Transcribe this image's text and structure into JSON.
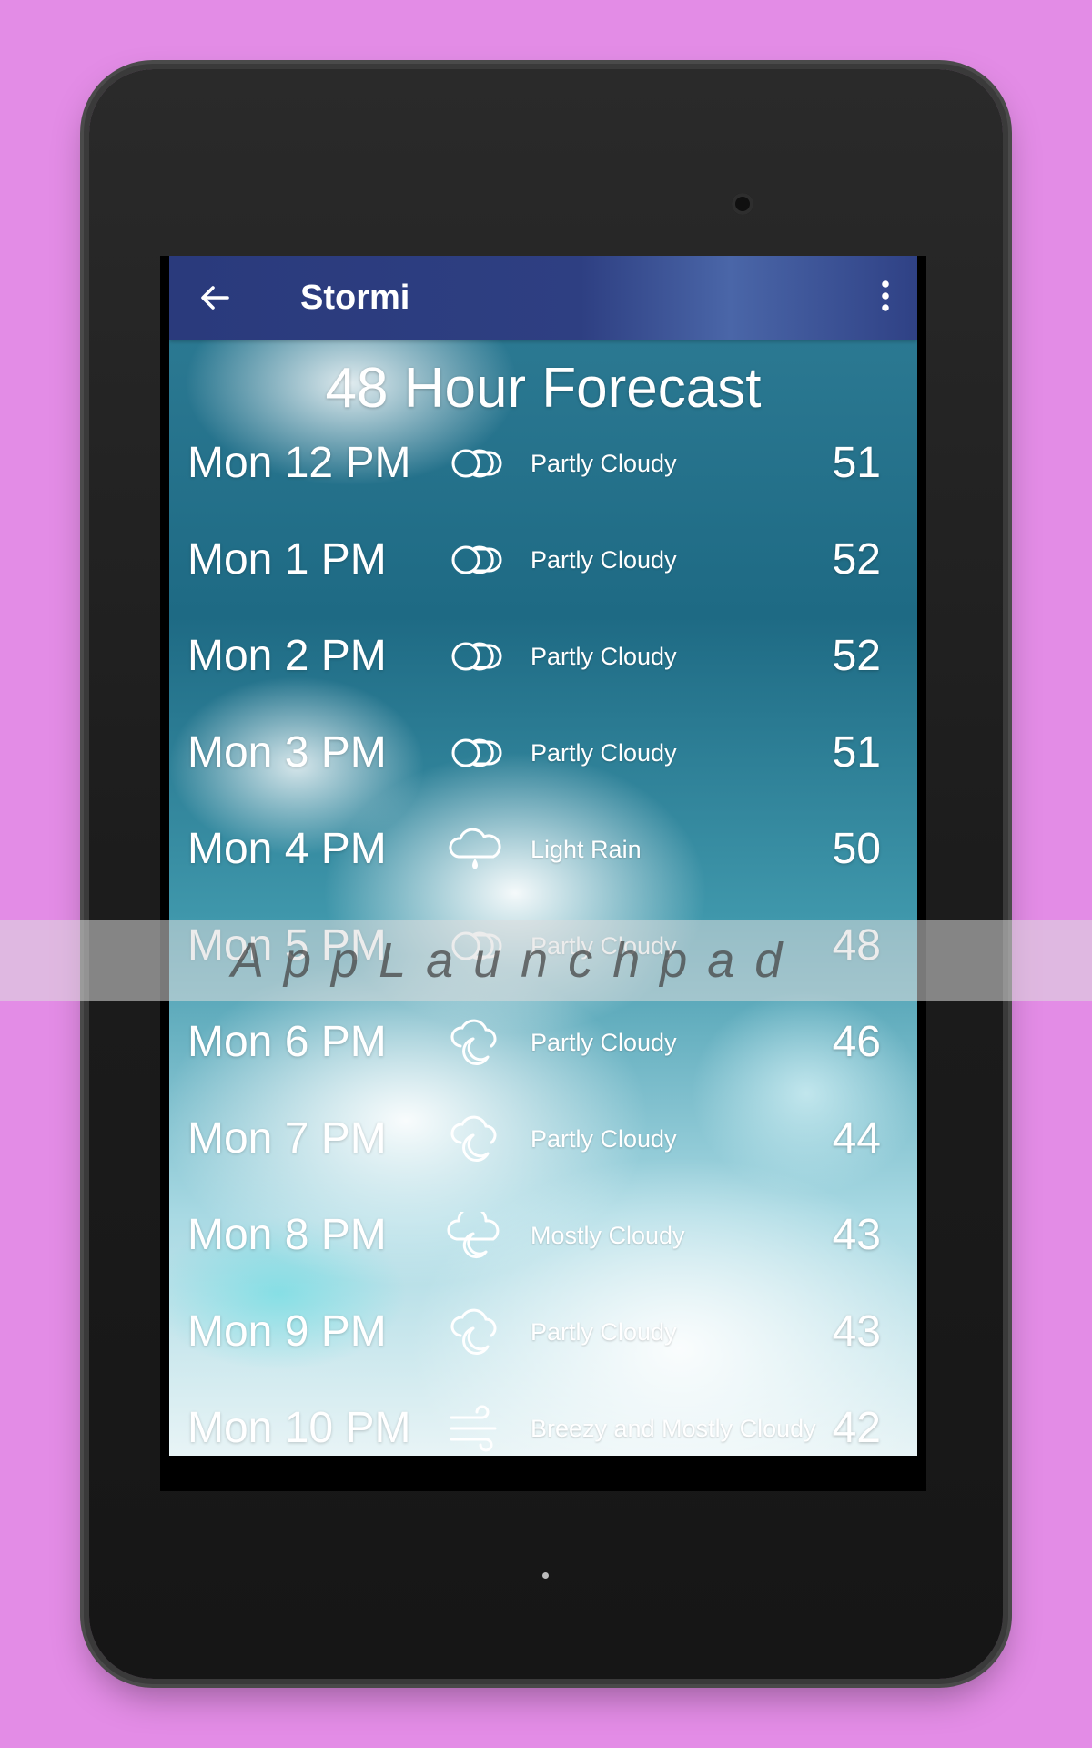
{
  "app": {
    "title": "Stormi",
    "page_title": "48 Hour Forecast"
  },
  "forecast": [
    {
      "time": "Mon 12 PM",
      "icon": "partly-cloudy-icon",
      "condition": "Partly Cloudy",
      "temp": "51"
    },
    {
      "time": "Mon 1 PM",
      "icon": "partly-cloudy-icon",
      "condition": "Partly Cloudy",
      "temp": "52"
    },
    {
      "time": "Mon 2 PM",
      "icon": "partly-cloudy-icon",
      "condition": "Partly Cloudy",
      "temp": "52"
    },
    {
      "time": "Mon 3 PM",
      "icon": "partly-cloudy-icon",
      "condition": "Partly Cloudy",
      "temp": "51"
    },
    {
      "time": "Mon 4 PM",
      "icon": "light-rain-icon",
      "condition": "Light Rain",
      "temp": "50"
    },
    {
      "time": "Mon 5 PM",
      "icon": "partly-cloudy-icon",
      "condition": "Partly Cloudy",
      "temp": "48"
    },
    {
      "time": "Mon 6 PM",
      "icon": "partly-cloudy-night-icon",
      "condition": "Partly Cloudy",
      "temp": "46"
    },
    {
      "time": "Mon 7 PM",
      "icon": "partly-cloudy-night-icon",
      "condition": "Partly Cloudy",
      "temp": "44"
    },
    {
      "time": "Mon 8 PM",
      "icon": "mostly-cloudy-night-icon",
      "condition": "Mostly Cloudy",
      "temp": "43"
    },
    {
      "time": "Mon 9 PM",
      "icon": "partly-cloudy-night-icon",
      "condition": "Partly Cloudy",
      "temp": "43"
    },
    {
      "time": "Mon 10 PM",
      "icon": "wind-icon",
      "condition": "Breezy and Mostly Cloudy",
      "temp": "42"
    }
  ],
  "watermark": {
    "text": "AppLaunchpad"
  },
  "colors": {
    "page_background": "#e38ce6",
    "appbar": "#2e3f82",
    "text": "#ffffff"
  }
}
